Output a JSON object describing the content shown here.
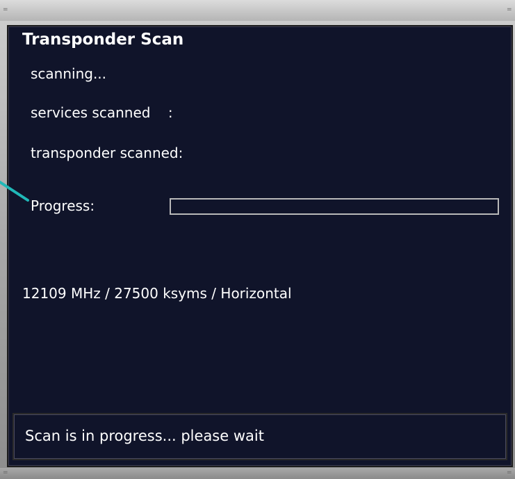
{
  "window": {
    "title": "Transponder Scan"
  },
  "scan": {
    "state_text": "scanning...",
    "services_label": "services scanned    :",
    "transponder_label": "transponder scanned:",
    "progress_label": "Progress:",
    "progress_value": 0,
    "frequency_info": "12109 MHz / 27500 ksyms / Horizontal"
  },
  "status": {
    "message": "Scan is in progress... please wait"
  },
  "colors": {
    "background": "#10142a",
    "text": "#ffffff",
    "progress_border": "#b9b9b9",
    "callout_arrow": "#20b8b8"
  }
}
